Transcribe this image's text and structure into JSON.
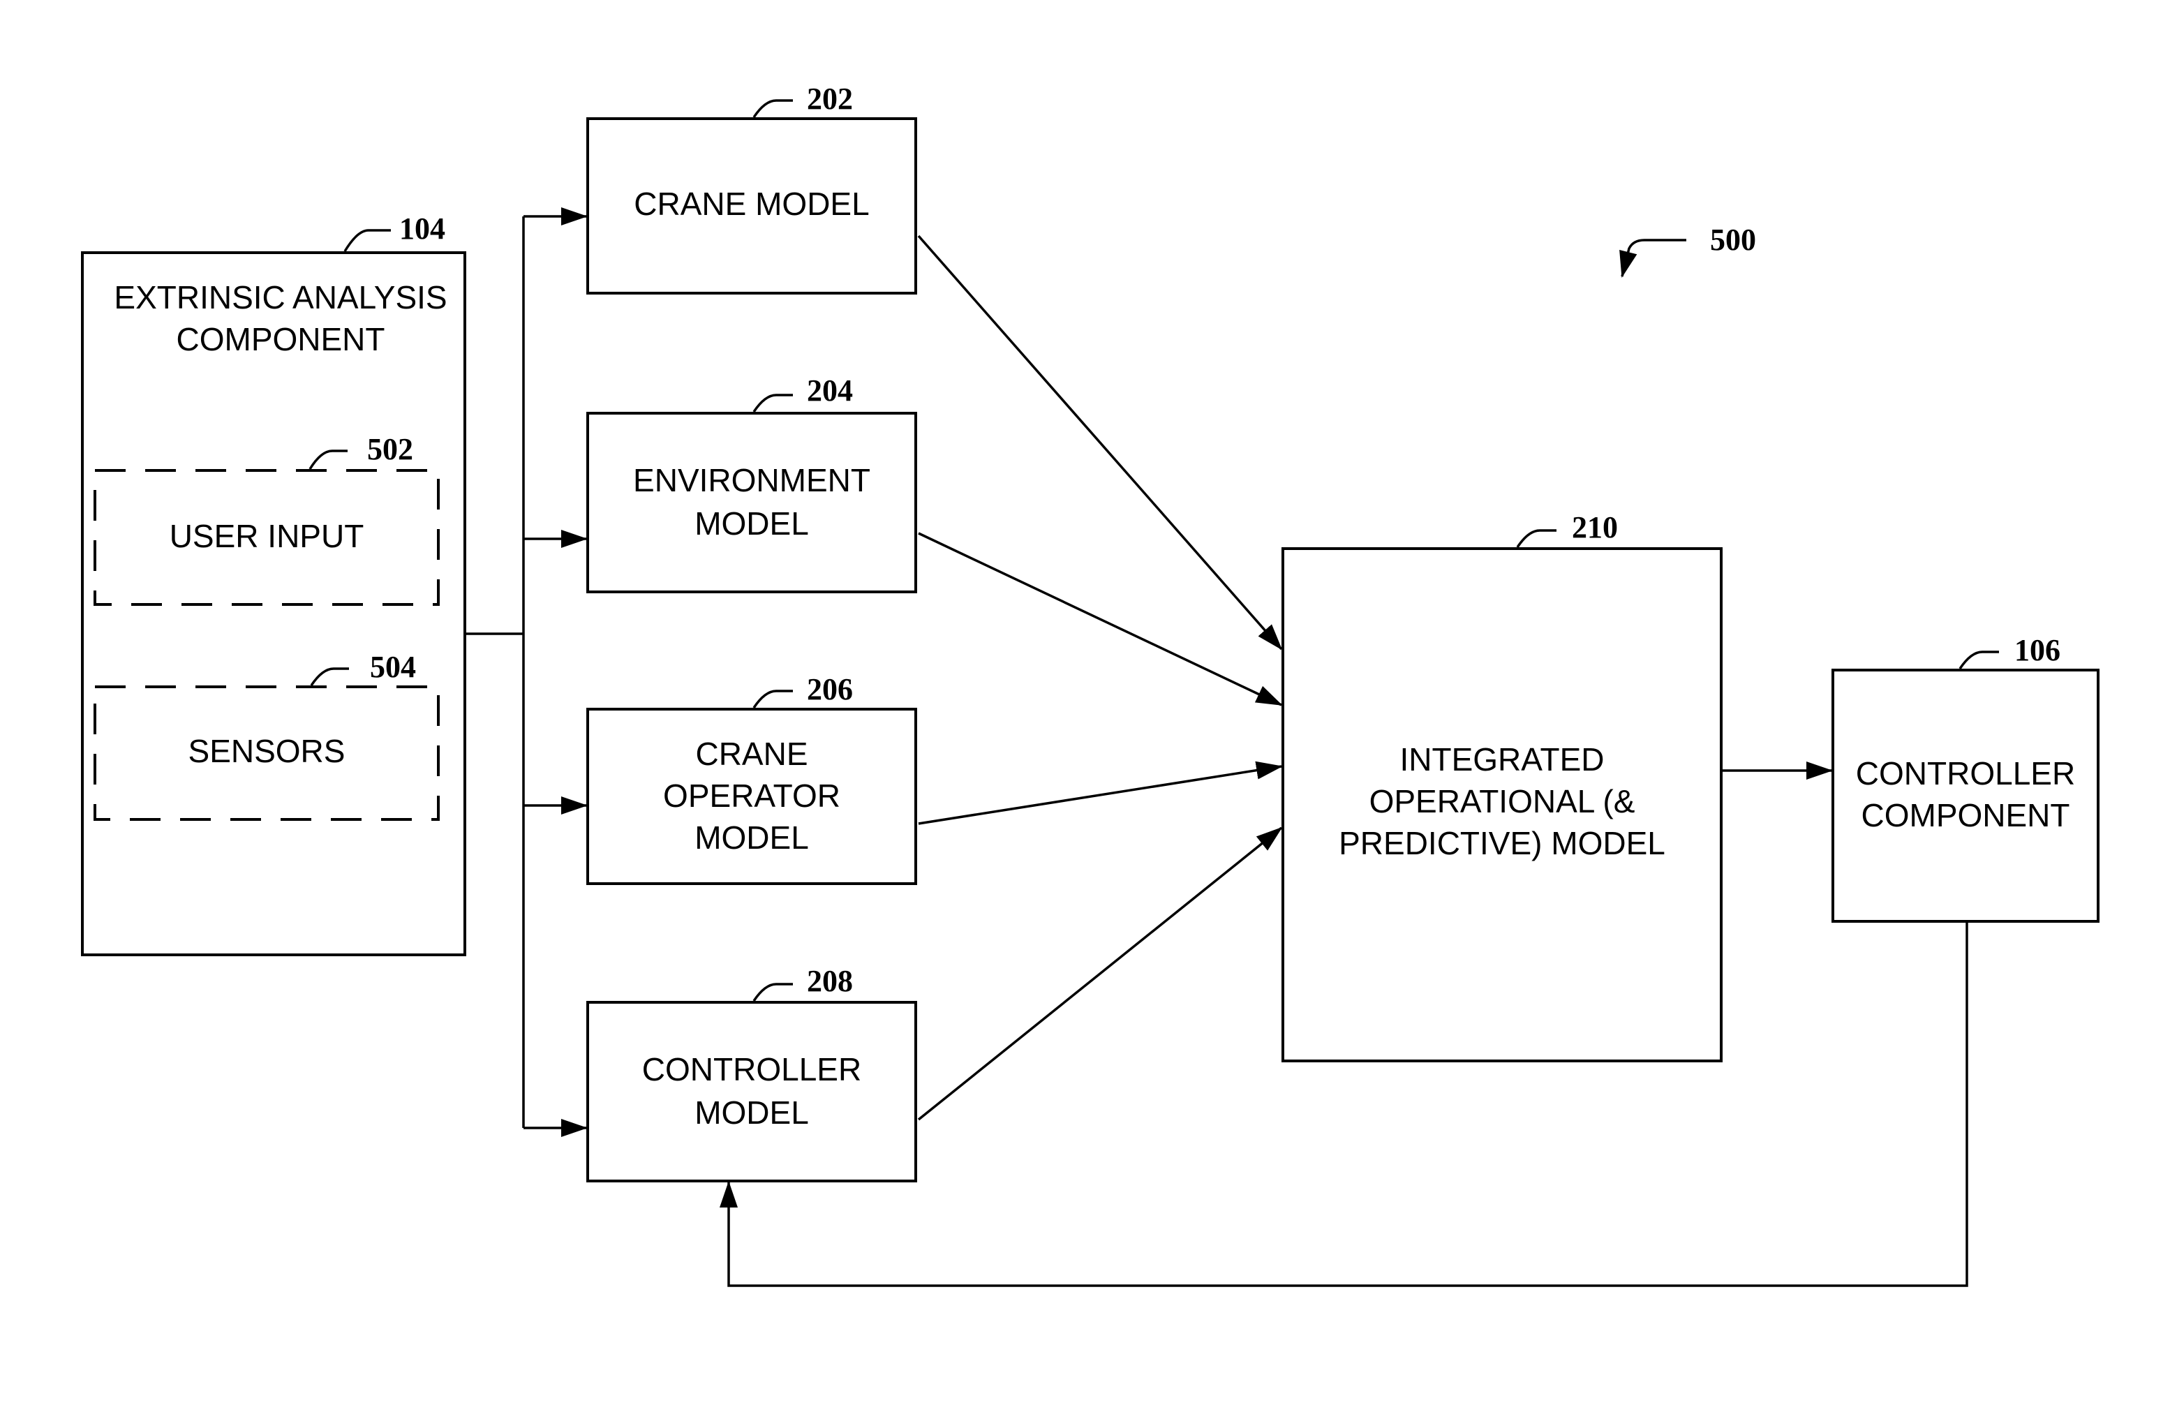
{
  "figure": {
    "ref": "500",
    "nodes": {
      "extrinsic": {
        "ref": "104",
        "lines": [
          "EXTRINSIC ANALYSIS",
          "COMPONENT"
        ]
      },
      "user_input": {
        "ref": "502",
        "lines": [
          "USER INPUT"
        ]
      },
      "sensors": {
        "ref": "504",
        "lines": [
          "SENSORS"
        ]
      },
      "crane_model": {
        "ref": "202",
        "lines": [
          "CRANE MODEL"
        ]
      },
      "environment_model": {
        "ref": "204",
        "lines": [
          "ENVIRONMENT",
          "MODEL"
        ]
      },
      "crane_operator_model": {
        "ref": "206",
        "lines": [
          "CRANE",
          "OPERATOR",
          "MODEL"
        ]
      },
      "controller_model": {
        "ref": "208",
        "lines": [
          "CONTROLLER",
          "MODEL"
        ]
      },
      "integrated_model": {
        "ref": "210",
        "lines": [
          "INTEGRATED",
          "OPERATIONAL (&",
          "PREDICTIVE) MODEL"
        ]
      },
      "controller_component": {
        "ref": "106",
        "lines": [
          "CONTROLLER",
          "COMPONENT"
        ]
      }
    },
    "edges": [
      [
        "extrinsic",
        "crane_model"
      ],
      [
        "extrinsic",
        "environment_model"
      ],
      [
        "extrinsic",
        "crane_operator_model"
      ],
      [
        "extrinsic",
        "controller_model"
      ],
      [
        "crane_model",
        "integrated_model"
      ],
      [
        "environment_model",
        "integrated_model"
      ],
      [
        "crane_operator_model",
        "integrated_model"
      ],
      [
        "controller_model",
        "integrated_model"
      ],
      [
        "integrated_model",
        "controller_component"
      ],
      [
        "controller_component",
        "controller_model"
      ]
    ]
  }
}
